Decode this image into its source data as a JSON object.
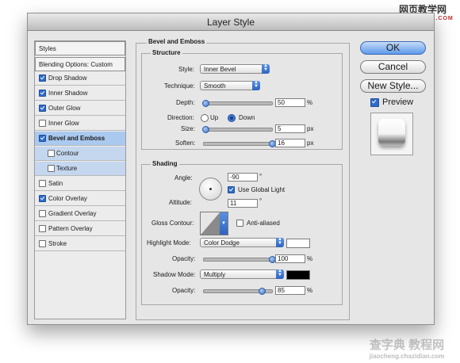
{
  "window": {
    "title": "Layer Style"
  },
  "watermark": {
    "top": "网页教学网",
    "top_url": "WWW.WEB3X.COM",
    "bottom": "查字典 教程网",
    "bottom_url": "jiaocheng.chazidian.com"
  },
  "styles_panel": {
    "header": "Styles",
    "blending": "Blending Options: Custom",
    "items": [
      {
        "label": "Drop Shadow",
        "checked": true
      },
      {
        "label": "Inner Shadow",
        "checked": true
      },
      {
        "label": "Outer Glow",
        "checked": true
      },
      {
        "label": "Inner Glow",
        "checked": false
      },
      {
        "label": "Bevel and Emboss",
        "checked": true,
        "active": true
      },
      {
        "label": "Contour",
        "checked": false,
        "sub": true
      },
      {
        "label": "Texture",
        "checked": false,
        "sub": true
      },
      {
        "label": "Satin",
        "checked": false
      },
      {
        "label": "Color Overlay",
        "checked": true
      },
      {
        "label": "Gradient Overlay",
        "checked": false
      },
      {
        "label": "Pattern Overlay",
        "checked": false
      },
      {
        "label": "Stroke",
        "checked": false
      }
    ]
  },
  "bevel": {
    "title": "Bevel and Emboss",
    "structure": {
      "title": "Structure",
      "style_label": "Style:",
      "style_value": "Inner Bevel",
      "technique_label": "Technique:",
      "technique_value": "Smooth",
      "depth_label": "Depth:",
      "depth_value": "50",
      "depth_unit": "%",
      "depth_level": 0.02,
      "direction_label": "Direction:",
      "up_label": "Up",
      "down_label": "Down",
      "direction": "Down",
      "size_label": "Size:",
      "size_value": "5",
      "size_unit": "px",
      "size_level": 0.02,
      "soften_label": "Soften:",
      "soften_value": "16",
      "soften_unit": "px",
      "soften_level": 1.0
    },
    "shading": {
      "title": "Shading",
      "angle_label": "Angle:",
      "angle_value": "-90",
      "angle_unit": "°",
      "global_light_label": "Use Global Light",
      "global_light": true,
      "altitude_label": "Altitude:",
      "altitude_value": "11",
      "altitude_unit": "°",
      "gloss_label": "Gloss Contour:",
      "anti_aliased_label": "Anti-aliased",
      "anti_aliased": false,
      "highlight_label": "Highlight Mode:",
      "highlight_value": "Color Dodge",
      "highlight_color": "#ffffff",
      "highlight_opacity_label": "Opacity:",
      "highlight_opacity": "100",
      "highlight_opacity_unit": "%",
      "highlight_opacity_level": 1.0,
      "shadow_label": "Shadow Mode:",
      "shadow_value": "Multiply",
      "shadow_color": "#000000",
      "shadow_opacity_label": "Opacity:",
      "shadow_opacity": "85",
      "shadow_opacity_unit": "%",
      "shadow_opacity_level": 0.85
    }
  },
  "buttons": {
    "ok": "OK",
    "cancel": "Cancel",
    "new_style": "New Style..."
  },
  "preview": {
    "label": "Preview",
    "checked": true
  },
  "colors": {
    "accent": "#3a74c8",
    "selection": "#aac9ef"
  }
}
